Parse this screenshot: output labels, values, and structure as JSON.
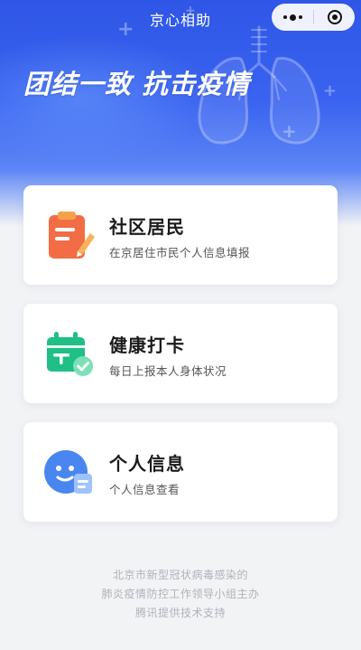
{
  "header": {
    "app_title": "京心相助",
    "capsule": {
      "more_icon": "more-dots-icon",
      "close_icon": "close-circle-icon"
    }
  },
  "banner": {
    "slogan": "团结一致 抗击疫情",
    "decoration_icon": "lungs-icon",
    "colors": {
      "top": "#2f56e6",
      "bottom": "#5d86f6"
    }
  },
  "cards": [
    {
      "title": "社区居民",
      "subtitle": "在京居住市民个人信息填报",
      "icon": "clipboard-edit-icon",
      "accent": "#f07048"
    },
    {
      "title": "健康打卡",
      "subtitle": "每日上报本人身体状况",
      "icon": "calendar-check-icon",
      "accent": "#23c08a"
    },
    {
      "title": "个人信息",
      "subtitle": "个人信息查看",
      "icon": "profile-face-icon",
      "accent": "#4a86f0"
    }
  ],
  "footer": {
    "lines": [
      "北京市新型冠状病毒感染的",
      "肺炎疫情防控工作领导小组主办",
      "腾讯提供技术支持"
    ]
  }
}
